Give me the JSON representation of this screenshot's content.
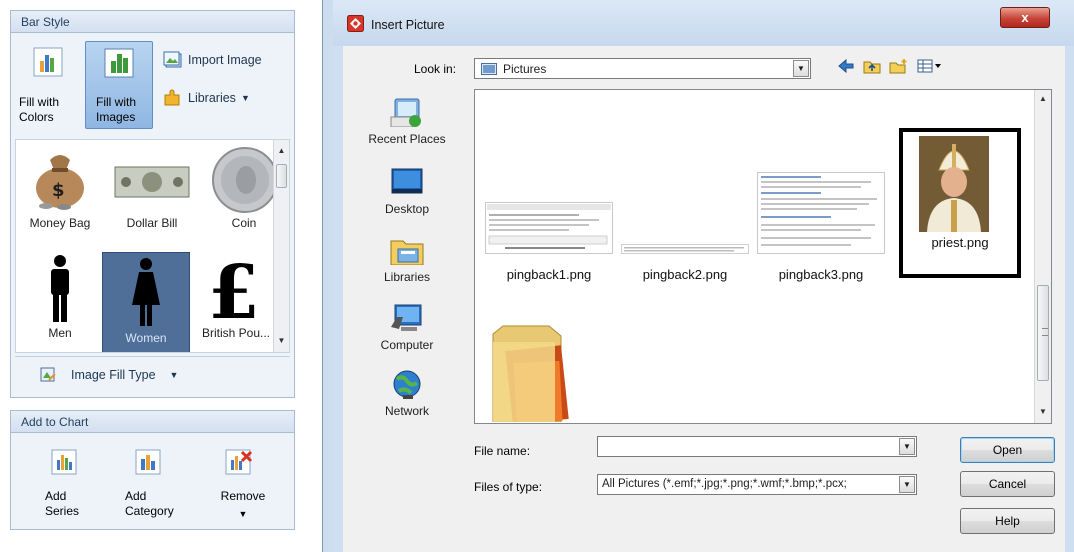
{
  "bar_style_panel": {
    "title": "Bar Style",
    "fill_colors_label": "Fill with\nColors",
    "fill_images_label": "Fill with\nImages",
    "import_image_label": "Import Image",
    "libraries_label": "Libraries",
    "gallery": [
      {
        "label": "Money Bag",
        "icon": "money-bag-icon",
        "selected": false
      },
      {
        "label": "Dollar Bill",
        "icon": "dollar-bill-icon",
        "selected": false
      },
      {
        "label": "Coin",
        "icon": "coin-icon",
        "selected": false
      },
      {
        "label": "Men",
        "icon": "man-icon",
        "selected": false
      },
      {
        "label": "Women",
        "icon": "woman-icon",
        "selected": true
      },
      {
        "label": "British Pou...",
        "icon": "pound-icon",
        "selected": false
      }
    ],
    "image_fill_type_label": "Image Fill Type"
  },
  "add_to_chart_panel": {
    "title": "Add to Chart",
    "add_series_label": "Add\nSeries",
    "add_category_label": "Add\nCategory",
    "remove_label": "Remove"
  },
  "dialog": {
    "title": "Insert Picture",
    "close_label": "x",
    "look_in_label": "Look in:",
    "look_in_value": "Pictures",
    "places": [
      {
        "label": "Recent Places",
        "icon": "recent-places-icon"
      },
      {
        "label": "Desktop",
        "icon": "desktop-icon"
      },
      {
        "label": "Libraries",
        "icon": "libraries-icon"
      },
      {
        "label": "Computer",
        "icon": "computer-icon"
      },
      {
        "label": "Network",
        "icon": "network-icon"
      }
    ],
    "files": [
      {
        "name": "pingback1.png"
      },
      {
        "name": "pingback2.png"
      },
      {
        "name": "pingback3.png"
      },
      {
        "name": "priest.png",
        "highlighted": true
      },
      {
        "name": ""
      }
    ],
    "file_name_label": "File name:",
    "file_name_value": "",
    "files_of_type_label": "Files of type:",
    "files_of_type_value": "All Pictures (*.emf;*.jpg;*.png;*.wmf;*.bmp;*.pcx;",
    "open_label": "Open",
    "cancel_label": "Cancel",
    "help_label": "Help"
  },
  "colors": {
    "selection_blue": "#4f6f98",
    "highlight_border": "#000000",
    "close_red": "#c7443a"
  }
}
